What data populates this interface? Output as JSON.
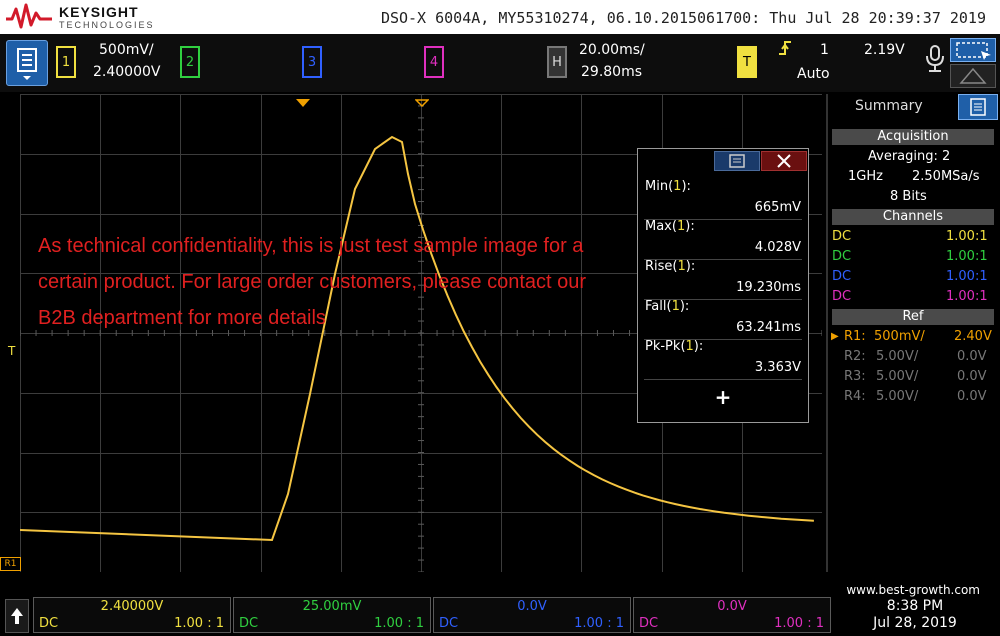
{
  "brand": {
    "name": "KEYSIGHT",
    "sub": "TECHNOLOGIES"
  },
  "device_info": "DSO-X 6004A, MY55310274, 06.10.2015061700: Thu Jul 28 20:39:37 2019",
  "channels": [
    {
      "num": "1",
      "color": "#f0e040",
      "scale": "500mV/",
      "offset": "2.40000V"
    },
    {
      "num": "2",
      "color": "#30d040"
    },
    {
      "num": "3",
      "color": "#3060ff"
    },
    {
      "num": "4",
      "color": "#e030c0"
    }
  ],
  "horizontal": {
    "label": "H",
    "scale": "20.00ms/",
    "delay": "29.80ms"
  },
  "trigger": {
    "label": "T",
    "source": "1",
    "level": "2.19V",
    "mode": "Auto"
  },
  "waveform_color": "#f5c542",
  "grid_marker_label": "R1",
  "left_marker": "T",
  "watermark": "As technical confidentiality, this is just test sample image for a certain product. For large order customers, please contact our B2B department for more details",
  "measurements": [
    {
      "label": "Min",
      "src": "1",
      "value": "665mV"
    },
    {
      "label": "Max",
      "src": "1",
      "value": "4.028V"
    },
    {
      "label": "Rise",
      "src": "1",
      "value": "19.230ms"
    },
    {
      "label": "Fall",
      "src": "1",
      "value": "63.241ms"
    },
    {
      "label": "Pk-Pk",
      "src": "1",
      "value": "3.363V"
    }
  ],
  "add_symbol": "+",
  "summary": {
    "title": "Summary",
    "acq_head": "Acquisition",
    "acq_mode": "Averaging: 2",
    "bandwidth": "1GHz",
    "rate": "2.50MSa/s",
    "bits": "8 Bits",
    "ch_head": "Channels",
    "ch_rows": [
      {
        "coupling": "DC",
        "probe": "1.00:1",
        "color": "#f0e040"
      },
      {
        "coupling": "DC",
        "probe": "1.00:1",
        "color": "#30d040"
      },
      {
        "coupling": "DC",
        "probe": "1.00:1",
        "color": "#3060ff"
      },
      {
        "coupling": "DC",
        "probe": "1.00:1",
        "color": "#e030c0"
      }
    ],
    "ref_head": "Ref",
    "ref_rows": [
      {
        "name": "R1:",
        "scale": "500mV/",
        "offset": "2.40V",
        "active": true
      },
      {
        "name": "R2:",
        "scale": "5.00V/",
        "offset": "0.0V",
        "active": false
      },
      {
        "name": "R3:",
        "scale": "5.00V/",
        "offset": "0.0V",
        "active": false
      },
      {
        "name": "R4:",
        "scale": "5.00V/",
        "offset": "0.0V",
        "active": false
      }
    ]
  },
  "bottom_channels": [
    {
      "value": "2.40000V",
      "coupling": "DC",
      "probe": "1.00 : 1",
      "color": "#f0e040"
    },
    {
      "value": "25.00mV",
      "coupling": "DC",
      "probe": "1.00 : 1",
      "color": "#30d040"
    },
    {
      "value": "0.0V",
      "coupling": "DC",
      "probe": "1.00 : 1",
      "color": "#3060ff"
    },
    {
      "value": "0.0V",
      "coupling": "DC",
      "probe": "1.00 : 1",
      "color": "#e030c0"
    }
  ],
  "footer": {
    "url": "www.best-growth.com",
    "time": "8:38 PM",
    "date": "Jul 28, 2019"
  }
}
